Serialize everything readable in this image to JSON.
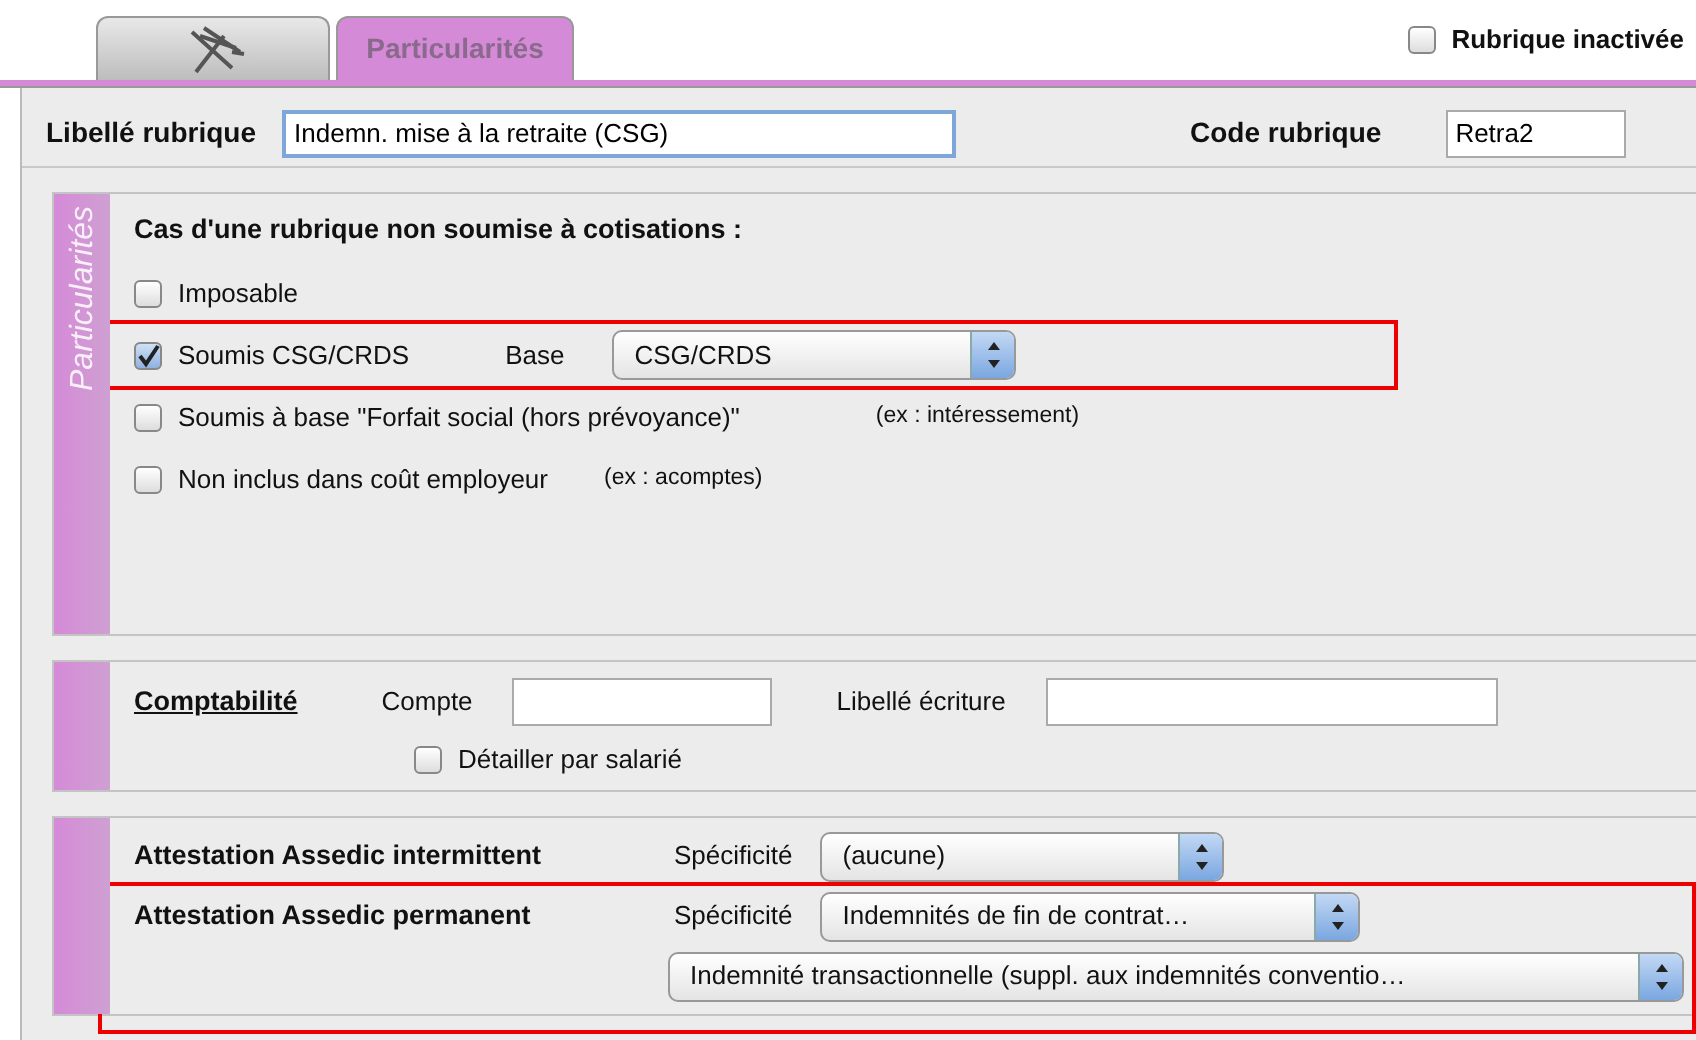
{
  "tabs": [
    {
      "kind": "icon",
      "selected": false
    },
    {
      "kind": "text",
      "label": "Particularités",
      "selected": true
    }
  ],
  "inactive_checkbox": {
    "label": "Rubrique inactivée",
    "checked": false
  },
  "header": {
    "libelle_label": "Libellé rubrique",
    "libelle_value": "Indemn. mise à la retraite (CSG)",
    "code_label": "Code rubrique",
    "code_value": "Retra2"
  },
  "particularites": {
    "side_label": "Particularités",
    "title": "Cas d'une rubrique non soumise à cotisations :",
    "options": [
      {
        "label": "Imposable",
        "checked": false,
        "highlighted": false
      },
      {
        "label": "Soumis CSG/CRDS",
        "checked": true,
        "highlighted": true,
        "base_label": "Base",
        "base_value": "CSG/CRDS"
      },
      {
        "label": "Soumis à base \"Forfait social (hors prévoyance)\"",
        "checked": false,
        "highlighted": false,
        "note": "(ex : intéressement)"
      },
      {
        "label": "Non inclus dans coût employeur",
        "checked": false,
        "highlighted": false,
        "note": "(ex : acomptes)"
      }
    ]
  },
  "comptabilite": {
    "title": "Comptabilité",
    "compte_label": "Compte",
    "ecriture_label": "Libellé écriture",
    "detail": {
      "label": "Détailler par salarié",
      "checked": false
    }
  },
  "attestations": [
    {
      "label": "Attestation Assedic intermittent",
      "spec_label": "Spécificité",
      "value": "(aucune)",
      "highlighted": false
    },
    {
      "label": "Attestation Assedic permanent",
      "spec_label": "Spécificité",
      "value": "Indemnités de fin de contrat…",
      "sub_value": "Indemnité transactionnelle (suppl. aux indemnités conventio…",
      "highlighted": true
    }
  ]
}
